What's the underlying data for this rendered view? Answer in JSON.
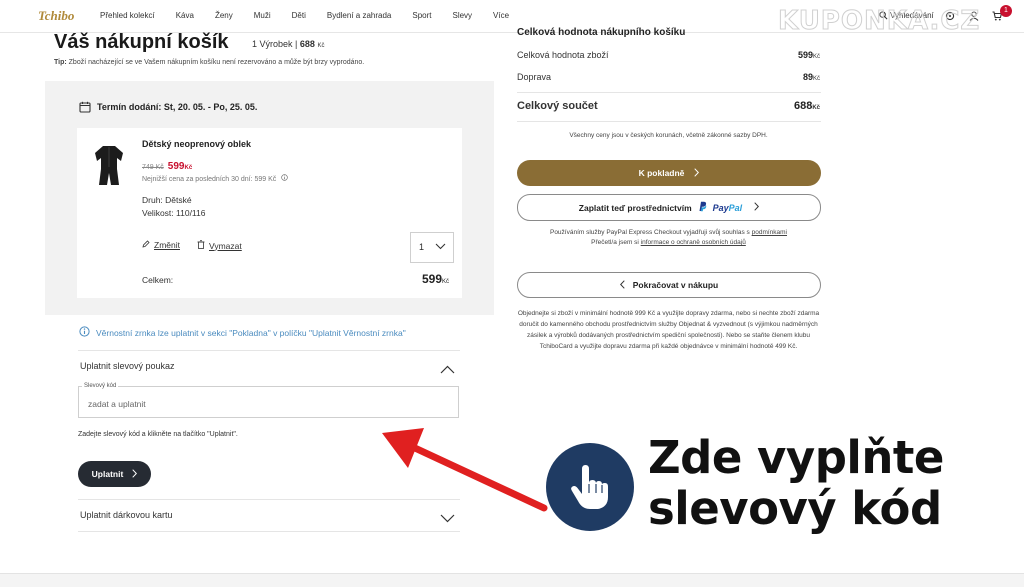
{
  "nav": {
    "logo": "Tchibo",
    "items": [
      "Přehled kolekcí",
      "Káva",
      "Ženy",
      "Muži",
      "Děti",
      "Bydlení a zahrada",
      "Sport",
      "Slevy",
      "Více"
    ],
    "search_label": "Vyhledávání",
    "cart_count": "1"
  },
  "watermark": "KUPONKA.CZ",
  "cart": {
    "title": "Váš nákupní košík",
    "count_label": "1 Výrobek |",
    "count_total": "688",
    "currency": "Kč",
    "tip_bold": "Tip:",
    "tip_text": "Zboží nacházející se ve Vašem nákupním košíku není rezervováno a může být brzy vyprodáno.",
    "delivery": "Termín dodání: St, 20. 05. - Po, 25. 05.",
    "product": {
      "name": "Dětský neoprenový oblek",
      "old_price": "749 Kč",
      "new_price": "599",
      "lowest_price": "Nejnižší cena za posledních 30 dní: 599 Kč",
      "attr_type": "Druh: Dětské",
      "attr_size": "Velikost: 110/116",
      "change_label": "Změnit",
      "remove_label": "Vymazat",
      "quantity": "1",
      "total_label": "Celkem:",
      "total_value": "599"
    }
  },
  "loyalty_text": "Věrnostní zrnka lze uplatnit v sekci \"Pokladna\" v políčku \"Uplatnit Věrnostní zrnka\"",
  "voucher": {
    "heading": "Uplatnit slevový poukaz",
    "field_label": "Slevový kód",
    "placeholder": "zadat a uplatnit",
    "hint": "Zadejte slevový kód a klikněte na tlačítko \"Uplatnit\".",
    "apply_label": "Uplatnit"
  },
  "gift_card_heading": "Uplatnit dárkovou kartu",
  "summary": {
    "header": "Celková hodnota nákupního košíku",
    "goods_label": "Celková hodnota zboží",
    "goods_value": "599",
    "shipping_label": "Doprava",
    "shipping_value": "89",
    "total_label": "Celkový součet",
    "total_value": "688",
    "currency": "Kč",
    "note": "Všechny ceny jsou v českých korunách, včetně zákonné sazby DPH.",
    "checkout_label": "K pokladně",
    "paypal_label": "Zaplatit teď prostřednictvím",
    "paypal_logo_a": "Pay",
    "paypal_logo_b": "Pal",
    "paypal_note_1": "Používáním služby PayPal Express Checkout vyjadřuji svůj souhlas s",
    "paypal_note_link1": "podmínkami",
    "paypal_note_2": "Přečetl/a jsem si",
    "paypal_note_link2": "informace o ochraně osobních údajů",
    "continue_label": "Pokračovat v nákupu",
    "shipping_note": "Objednejte si zboží v minimální hodnotě 999 Kč a využijte dopravy zdarma, nebo si nechte zboží zdarma doručit do kamenného obchodu prostřednictvím služby Objednat & vyzvednout (s výjimkou nadměrných zásilek a výrobků dodávaných prostřednictvím spediční společnosti). Nebo se staňte členem klubu TchiboCard a využijte dopravu zdarma při každé objednávce v minimální hodnotě 499 Kč."
  },
  "callout": {
    "line1": "Zde vyplňte",
    "line2": "slevový kód"
  },
  "colors": {
    "checkout": "#8a6d35",
    "apply": "#262b33",
    "sale_red": "#c8102e",
    "arrow_red": "#e02020",
    "callout_circle": "#1f3b63"
  }
}
